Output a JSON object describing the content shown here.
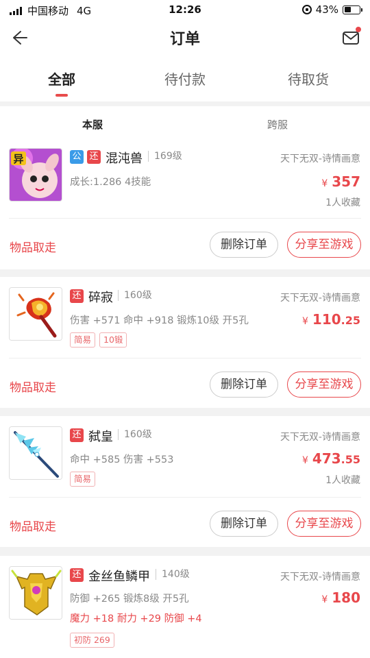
{
  "status_bar": {
    "carrier": "中国移动",
    "network": "4G",
    "time": "12:26",
    "battery": "43%",
    "battery_level": 0.43
  },
  "header": {
    "title": "订单"
  },
  "tabs": [
    {
      "label": "全部",
      "active": true
    },
    {
      "label": "待付款",
      "active": false
    },
    {
      "label": "待取货",
      "active": false
    }
  ],
  "subtabs": [
    {
      "label": "本服",
      "active": true
    },
    {
      "label": "跨服",
      "active": false
    }
  ],
  "orders": [
    {
      "badges": [
        "公",
        "还"
      ],
      "name": "混沌兽",
      "level": "169级",
      "server": "天下无双-诗情画意",
      "desc": "成长:1.286 4技能",
      "price_currency": "¥",
      "price_int": "357",
      "price_dec": "",
      "favorites": "1人收藏",
      "tags": [],
      "pickup": "物品取走",
      "delete_label": "删除订单",
      "share_label": "分享至游戏"
    },
    {
      "badges": [
        "还"
      ],
      "name": "碎寂",
      "level": "160级",
      "server": "天下无双-诗情画意",
      "desc": "伤害 +571 命中 +918 锻炼10级 开5孔",
      "price_currency": "¥",
      "price_int": "110",
      "price_dec": ".25",
      "favorites": "",
      "tags": [
        "简易",
        "10锻"
      ],
      "pickup": "物品取走",
      "delete_label": "删除订单",
      "share_label": "分享至游戏"
    },
    {
      "badges": [
        "还"
      ],
      "name": "弑皇",
      "level": "160级",
      "server": "天下无双-诗情画意",
      "desc": "命中 +585 伤害 +553",
      "price_currency": "¥",
      "price_int": "473",
      "price_dec": ".55",
      "favorites": "1人收藏",
      "tags": [
        "简易"
      ],
      "pickup": "物品取走",
      "delete_label": "删除订单",
      "share_label": "分享至游戏"
    },
    {
      "badges": [
        "还"
      ],
      "name": "金丝鱼鳞甲",
      "level": "140级",
      "server": "天下无双-诗情画意",
      "desc": "防御 +265 锻炼8级 开5孔",
      "red_desc": "魔力 +18 耐力 +29 防御 +4",
      "price_currency": "¥",
      "price_int": "180",
      "price_dec": "",
      "favorites": "",
      "tags": [
        "初防 269"
      ]
    }
  ],
  "colors": {
    "accent": "#e8474b",
    "blue_badge": "#3a9be8",
    "background": "#f2f2f2"
  }
}
